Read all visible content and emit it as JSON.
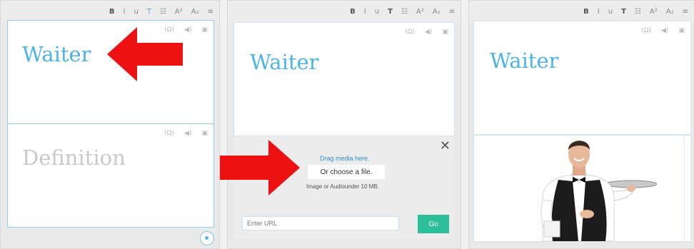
{
  "toolbar": {
    "items": [
      "B",
      "I",
      "u",
      "T",
      "☷",
      "A²",
      "A₂",
      "≡"
    ]
  },
  "card_tools": {
    "image": "(Ω)",
    "audio_icon": "speaker-icon",
    "camera_icon": "camera-icon"
  },
  "panel1": {
    "front_word": "Waiter",
    "back_word": "Definition"
  },
  "panel2": {
    "front_word": "Waiter",
    "media": {
      "drag_label": "Drag media here.",
      "choose_label": "Or choose a file.",
      "limit_note": "Image or Audiounder 10 MB."
    },
    "url_placeholder": "Enter URL",
    "go_label": "Go"
  },
  "panel3": {
    "front_word": "Waiter",
    "image_subject": "waiter holding a serving tray"
  },
  "colors": {
    "accent": "#4bb4ea",
    "arrow": "#ee1111",
    "go_button": "#2cbf9a"
  }
}
